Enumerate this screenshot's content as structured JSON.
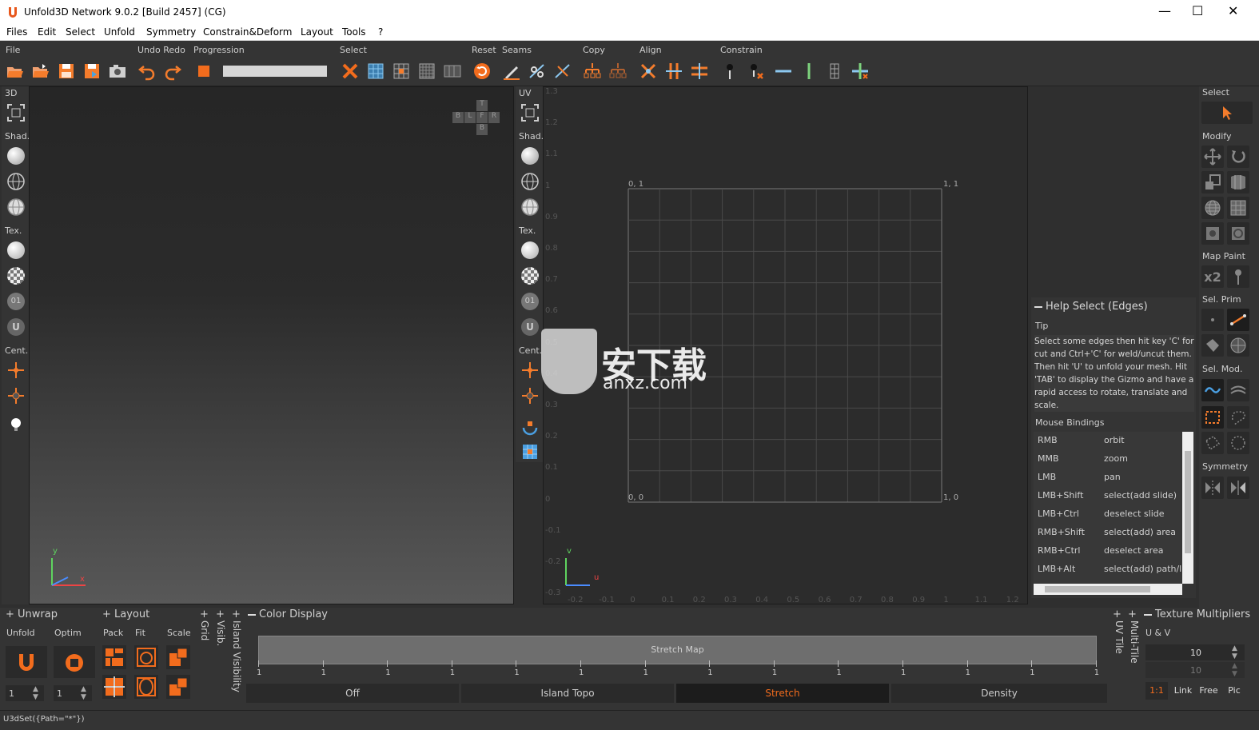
{
  "window": {
    "title": "Unfold3D Network 9.0.2 [Build 2457] (CG)",
    "minimize": "—",
    "maximize": "☐",
    "close": "✕"
  },
  "menu": [
    "Files",
    "Edit",
    "Select",
    "Unfold",
    "Symmetry",
    "Constrain&Deform",
    "Layout",
    "Tools",
    "?"
  ],
  "toolbar": {
    "groups": {
      "file": "File",
      "undo_redo": "Undo Redo",
      "progression": "Progression",
      "select": "Select",
      "reset": "Reset",
      "seams": "Seams",
      "copy": "Copy",
      "align": "Align",
      "constrain": "Constrain"
    }
  },
  "left_sidebar": {
    "view": "3D",
    "shading": "Shad.",
    "texture": "Tex.",
    "center": "Cent."
  },
  "uv_sidebar": {
    "view": "UV",
    "shading": "Shad.",
    "texture": "Tex.",
    "center": "Cent."
  },
  "viewport3d": {
    "cube": {
      "top": "T",
      "left_b": "B",
      "left": "L",
      "front": "F",
      "right": "R",
      "bottom": "B"
    },
    "axis_x": "x",
    "axis_y": "y"
  },
  "uv_viewport": {
    "corner_tl": "0, 1",
    "corner_tr": "1, 1",
    "corner_bl": "0, 0",
    "corner_br": "1, 0",
    "y_ticks": [
      "1.3",
      "1.2",
      "1.1",
      "1",
      "0.9",
      "0.8",
      "0.7",
      "0.6",
      "0.5",
      "0.4",
      "0.3",
      "0.2",
      "0.1",
      "0",
      "-0.1",
      "-0.2",
      "-0.3"
    ],
    "x_ticks": [
      "-0.2",
      "-0.1",
      "0",
      "0.1",
      "0.2",
      "0.3",
      "0.4",
      "0.5",
      "0.6",
      "0.7",
      "0.8",
      "0.9",
      "1",
      "1.1",
      "1.2"
    ],
    "axis_u": "u",
    "axis_v": "v",
    "watermark_text": "安下载",
    "watermark_sub": "anxz.com"
  },
  "right_panel": {
    "select": "Select",
    "modify": "Modify",
    "map_paint": "Map Paint",
    "map_paint_x2": "x2",
    "sel_prim": "Sel. Prim",
    "sel_mod": "Sel. Mod.",
    "symmetry": "Symmetry"
  },
  "help": {
    "title": "Help Select (Edges)",
    "tip_label": "Tip",
    "tip_text": "Select some edges then hit key 'C' for cut and Ctrl+'C' for weld/uncut them. Then hit 'U' to unfold your mesh. Hit 'TAB' to display the Gizmo and have a rapid access to rotate, translate and scale.",
    "mouse_label": "Mouse Bindings",
    "bindings": [
      {
        "key": "RMB",
        "action": "orbit"
      },
      {
        "key": "MMB",
        "action": "zoom"
      },
      {
        "key": "LMB",
        "action": "pan"
      },
      {
        "key": "LMB+Shift",
        "action": "select(add slide)"
      },
      {
        "key": "LMB+Ctrl",
        "action": "deselect slide"
      },
      {
        "key": "RMB+Shift",
        "action": "select(add) area"
      },
      {
        "key": "RMB+Ctrl",
        "action": "deselect area"
      },
      {
        "key": "LMB+Alt",
        "action": "select(add) path/lo"
      }
    ]
  },
  "bottom": {
    "unwrap": "Unwrap",
    "unfold": "Unfold",
    "optim": "Optim",
    "unfold_val": "1",
    "optim_val": "1",
    "layout": "Layout",
    "pack": "Pack",
    "fit": "Fit",
    "scale": "Scale",
    "grid": "Grid",
    "visib": "Visib.",
    "island_visibility": "Island Visibility",
    "color_display": "Color Display",
    "stretch_map": "Stretch Map",
    "scale_ticks": [
      "1",
      "1",
      "1",
      "1",
      "1",
      "1",
      "1",
      "1",
      "1",
      "1",
      "1",
      "1",
      "1",
      "1"
    ],
    "modes": [
      "Off",
      "Island Topo",
      "Stretch",
      "Density"
    ],
    "active_mode": "Stretch",
    "uv_tile": "UV Tile",
    "multi_tile": "Multi-Tile",
    "texture_multipliers": "Texture Multipliers",
    "u_v": "U & V",
    "u_val": "10",
    "v_val": "10",
    "ratio": "1:1",
    "link": "Link",
    "free": "Free",
    "pic": "Pic"
  },
  "status": "U3dSet({Path=\"*\"})",
  "colors": {
    "accent": "#f26c1d",
    "bg": "#2f2f2f",
    "panel": "#343434"
  }
}
